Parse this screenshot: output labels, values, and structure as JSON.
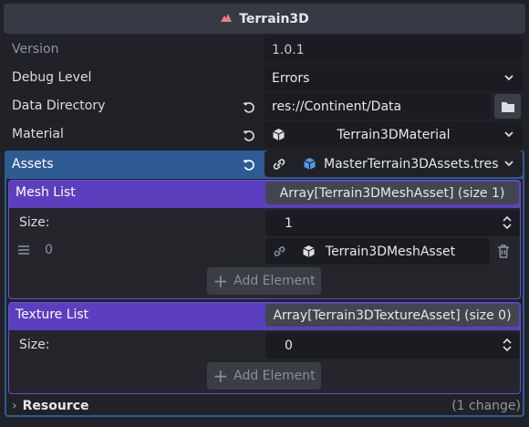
{
  "header": {
    "title": "Terrain3D",
    "icon": "terrain-node-icon"
  },
  "properties": {
    "version": {
      "label": "Version",
      "value": "1.0.1"
    },
    "debug_level": {
      "label": "Debug Level",
      "value": "Errors"
    },
    "data_directory": {
      "label": "Data Directory",
      "value": "res://Continent/Data"
    },
    "material": {
      "label": "Material",
      "value": "Terrain3DMaterial"
    },
    "assets": {
      "label": "Assets",
      "value": "MasterTerrain3DAssets.tres"
    }
  },
  "mesh_list": {
    "title": "Mesh List",
    "array_label": "Array[Terrain3DMeshAsset] (size 1)",
    "size_label": "Size:",
    "size_value": "1",
    "items": [
      {
        "index": "0",
        "value": "Terrain3DMeshAsset"
      }
    ],
    "add_label": "Add Element"
  },
  "texture_list": {
    "title": "Texture List",
    "array_label": "Array[Terrain3DTextureAsset] (size 0)",
    "size_label": "Size:",
    "size_value": "0",
    "add_label": "Add Element"
  },
  "resource": {
    "label": "Resource",
    "changes": "(1 change)"
  },
  "colors": {
    "background": "#202227",
    "assets_accent": "#2f5b94",
    "list_accent": "#5b3fbf",
    "field_bg": "#1a1c21"
  }
}
